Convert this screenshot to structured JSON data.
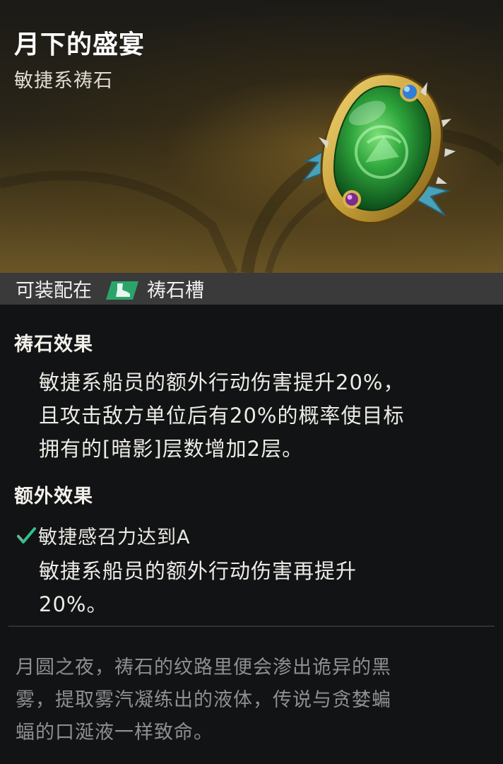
{
  "item": {
    "name": "月下的盛宴",
    "type": "敏捷系祷石"
  },
  "equip": {
    "prefix": "可装配在",
    "slot_icon": "boot-slot-icon",
    "slot_label": "祷石槽"
  },
  "effect": {
    "heading": "祷石效果",
    "line1": "敏捷系船员的额外行动伤害提升20%，",
    "line2": "且攻击敌方单位后有20%的概率使目标",
    "line3_pre": "拥有的",
    "line3_tag": "[暗影]",
    "line3_post": "层数增加2层。"
  },
  "extra": {
    "heading": "额外效果",
    "condition_icon": "check-icon",
    "condition": "敏捷感召力达到A",
    "line1": "敏捷系船员的额外行动伤害再提升",
    "line2": "20%。"
  },
  "flavor": {
    "line1": "月圆之夜，祷石的纹路里便会渗出诡异的黑",
    "line2": "雾，提取雾汽凝练出的液体，传说与贪婪蝙",
    "line3": "蝠的口涎液一样致命。"
  },
  "colors": {
    "accent_green": "#2aa56a",
    "gem_gold": "#c9a23a",
    "gem_green": "#2fa63c"
  }
}
